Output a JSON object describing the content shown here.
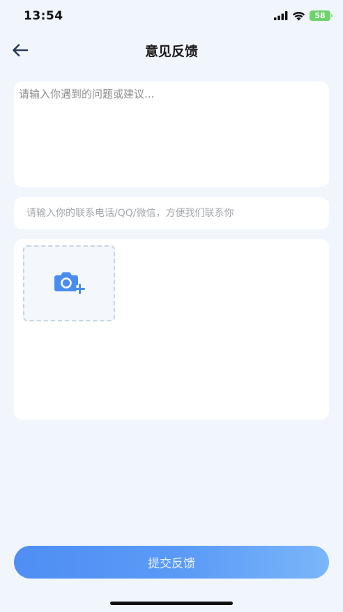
{
  "status_bar": {
    "time": "13:54",
    "battery": "58",
    "icons": [
      "signal-icon",
      "wifi-icon",
      "battery-charging-icon"
    ]
  },
  "nav": {
    "title": "意见反馈",
    "back_icon": "arrow-left-icon"
  },
  "feedback": {
    "placeholder": "请输入你遇到的问题或建议...",
    "value": ""
  },
  "contact": {
    "placeholder": "请输入你的联系电话/QQ/微信，方便我们联系你",
    "value": ""
  },
  "upload": {
    "icon": "camera-add-icon"
  },
  "submit": {
    "label": "提交反馈"
  },
  "colors": {
    "background": "#f1f6fd",
    "card": "#ffffff",
    "accent_start": "#4f8ef4",
    "accent_end": "#7bb6fa",
    "camera_icon": "#4a8cf0",
    "battery": "#6dd36a"
  }
}
